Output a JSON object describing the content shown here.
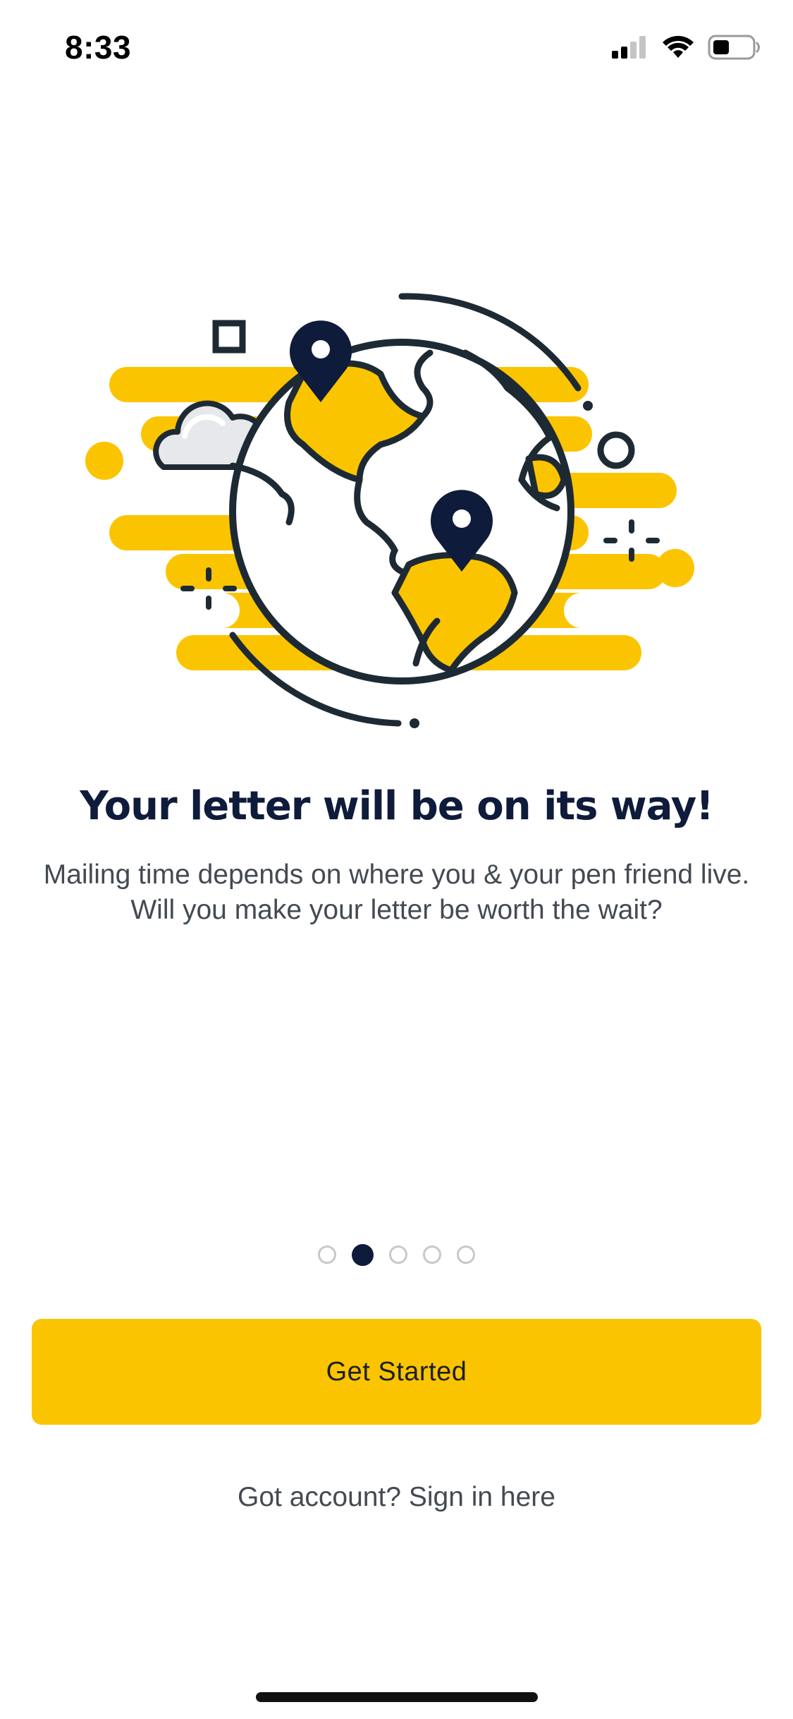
{
  "status_bar": {
    "time": "8:33",
    "icons": [
      "cellular-signal-icon",
      "wifi-icon",
      "battery-icon"
    ]
  },
  "illustration": {
    "name": "globe-with-location-pins",
    "colors": {
      "accent": "#fbc400",
      "outline": "#1e2a33",
      "pin": "#0f1b3a",
      "cloud": "#e6e8ec"
    }
  },
  "onboarding": {
    "title": "Your letter will be on its way!",
    "subtitle": "Mailing time depends on where you & your pen friend live. Will you make your letter be worth the wait?",
    "page_indicator": {
      "total": 5,
      "current": 2
    }
  },
  "actions": {
    "primary_label": "Get Started",
    "signin_label": "Got account? Sign in here"
  },
  "colors": {
    "primary_button": "#fbc400",
    "title_text": "#0f1b3a",
    "body_text": "#444a52",
    "dot_active": "#0f1b3a",
    "dot_inactive": "#c8c8c8"
  }
}
